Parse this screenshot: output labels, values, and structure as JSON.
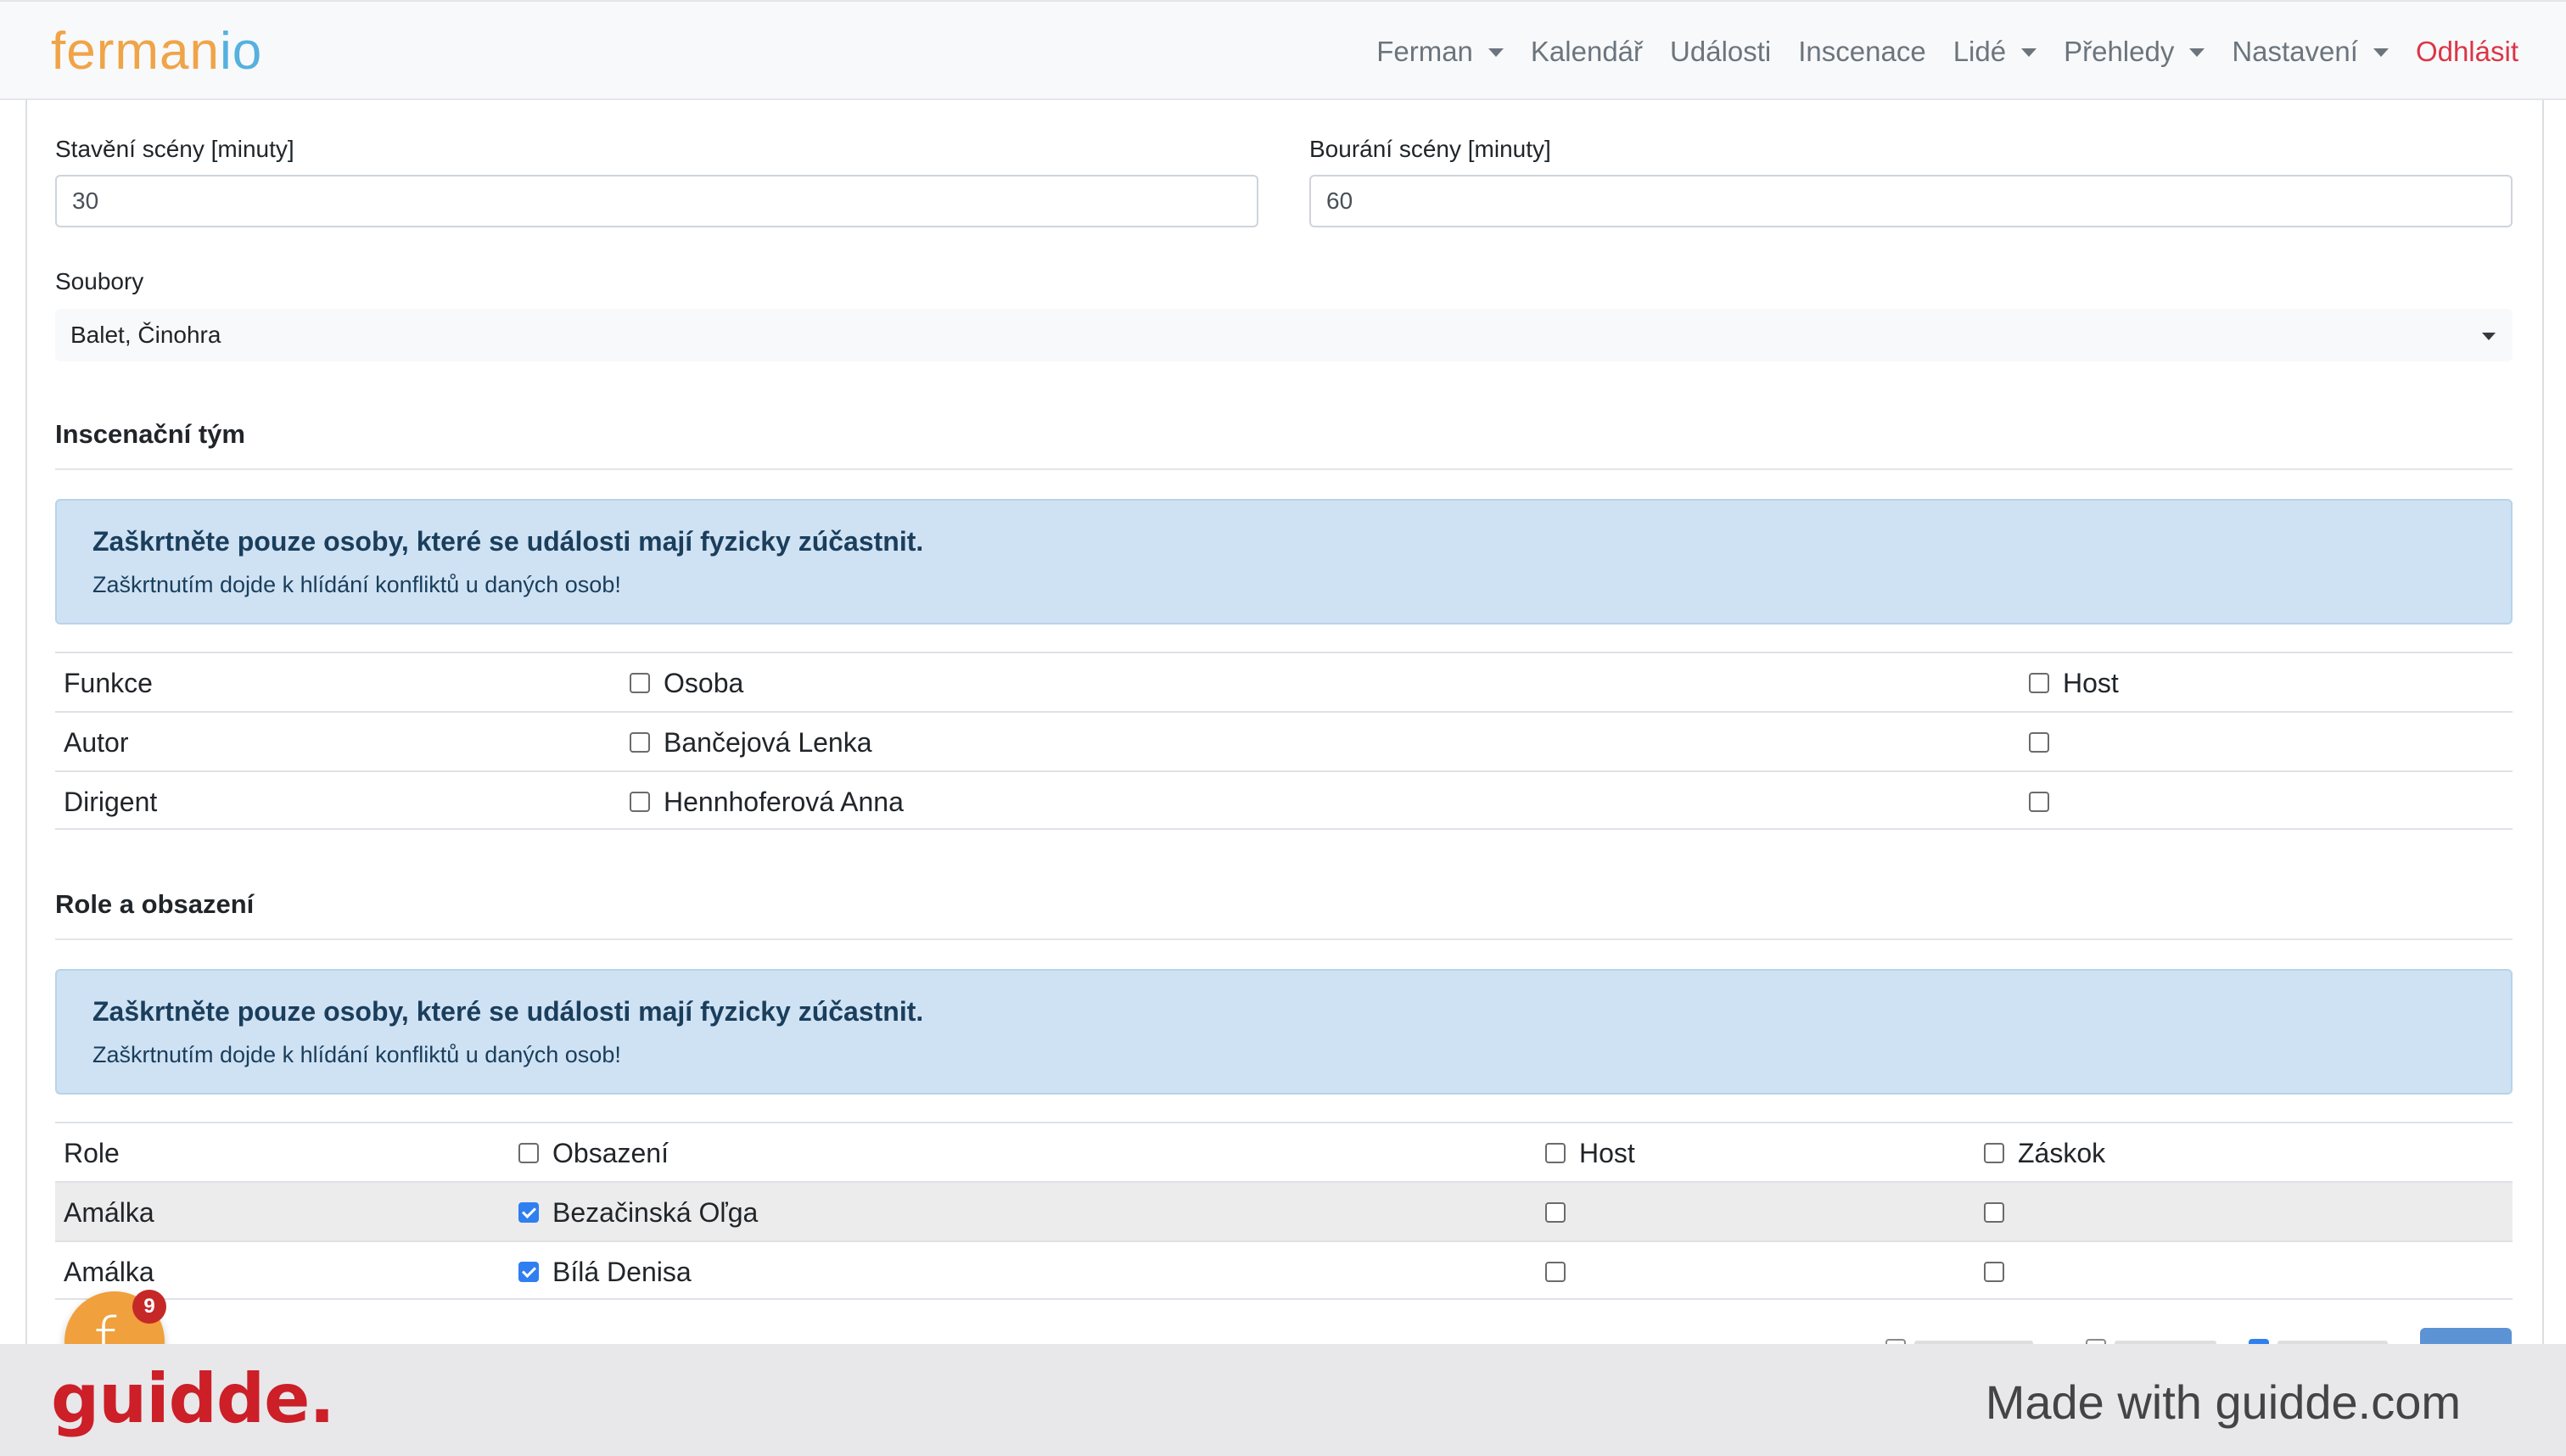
{
  "navbar": {
    "brand_part1": "ferman",
    "brand_part2": "io",
    "items": [
      {
        "label": "Ferman",
        "dropdown": true
      },
      {
        "label": "Kalendář",
        "dropdown": false
      },
      {
        "label": "Události",
        "dropdown": false
      },
      {
        "label": "Inscenace",
        "dropdown": false
      },
      {
        "label": "Lidé",
        "dropdown": true
      },
      {
        "label": "Přehledy",
        "dropdown": true
      },
      {
        "label": "Nastavení",
        "dropdown": true
      }
    ],
    "logout_label": "Odhlásit"
  },
  "form": {
    "setup_label": "Stavění scény [minuty]",
    "setup_value": "30",
    "teardown_label": "Bourání scény [minuty]",
    "teardown_value": "60",
    "ensembles_label": "Soubory",
    "ensembles_value": "Balet, Činohra"
  },
  "team": {
    "title": "Inscenační tým",
    "alert_title": "Zaškrtněte pouze osoby, které se události mají fyzicky zúčastnit.",
    "alert_text": "Zaškrtnutím dojde k hlídání konfliktů u daných osob!",
    "headers": {
      "function": "Funkce",
      "person": "Osoba",
      "guest": "Host"
    },
    "rows": [
      {
        "function": "Autor",
        "person": "Bančejová Lenka",
        "person_checked": false,
        "guest_checked": false
      },
      {
        "function": "Dirigent",
        "person": "Hennhoferová Anna",
        "person_checked": false,
        "guest_checked": false
      }
    ]
  },
  "roles": {
    "title": "Role a obsazení",
    "alert_title": "Zaškrtněte pouze osoby, které se události mají fyzicky zúčastnit.",
    "alert_text": "Zaškrtnutím dojde k hlídání konfliktů u daných osob!",
    "headers": {
      "role": "Role",
      "cast": "Obsazení",
      "guest": "Host",
      "substitute": "Záskok"
    },
    "rows": [
      {
        "role": "Amálka",
        "cast": "Bezačinská Oľga",
        "cast_checked": true,
        "guest_checked": false,
        "sub_checked": false
      },
      {
        "role": "Amálka",
        "cast": "Bílá Denisa",
        "cast_checked": true,
        "guest_checked": false,
        "sub_checked": false
      }
    ]
  },
  "widget": {
    "letter": "f",
    "badge_count": "9"
  },
  "footer": {
    "logo": "guidde.",
    "made_with": "Made with guidde.com"
  },
  "colors": {
    "brand_orange": "#f0a448",
    "brand_blue": "#55b1de",
    "danger": "#dc3545",
    "alert_bg": "#cfe2f3",
    "checkbox_blue": "#2f7ff0",
    "guidde_red": "#cc1f28"
  }
}
